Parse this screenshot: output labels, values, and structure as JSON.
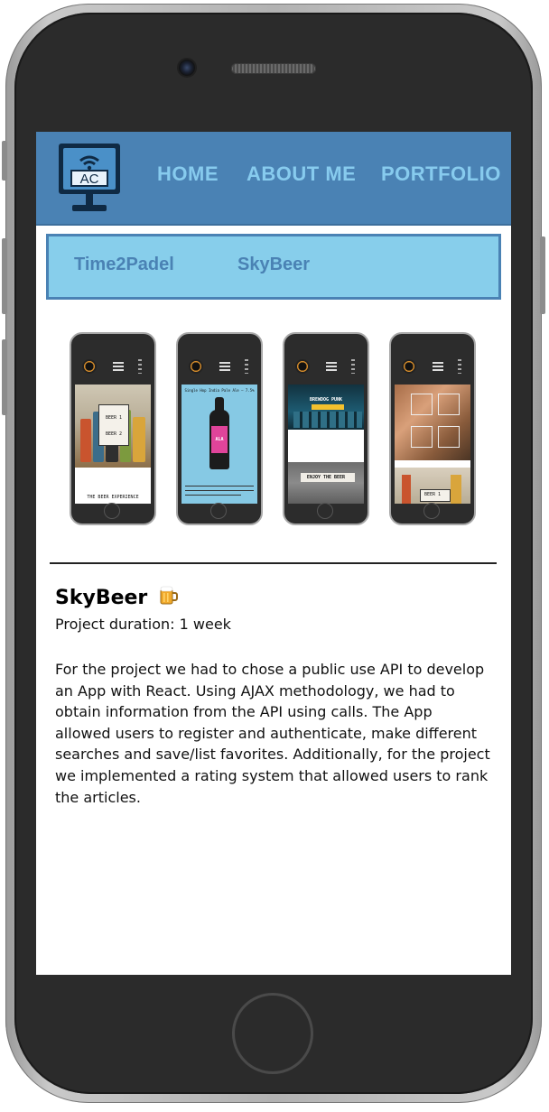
{
  "nav": {
    "logo_text": "AC",
    "links": [
      {
        "label": "HOME"
      },
      {
        "label": "ABOUT ME"
      },
      {
        "label": "PORTFOLIO"
      }
    ]
  },
  "projects_bar": {
    "items": [
      {
        "label": "Time2Padel"
      },
      {
        "label": "SkyBeer"
      }
    ]
  },
  "gallery": {
    "screens": [
      {
        "captions": [
          "BEER 1",
          "BEER 2",
          "THE BEER EXPERIENCE"
        ]
      },
      {
        "captions": [
          "Single Hop India Pale Ale — 7.5%",
          "ALA"
        ]
      },
      {
        "captions": [
          "BREWDOG PUNK",
          "ENJOY THE BEER"
        ]
      },
      {
        "captions": [
          "BEER 1"
        ]
      }
    ]
  },
  "project": {
    "title": "SkyBeer",
    "emoji": "🍺",
    "duration": "Project duration: 1 week",
    "description": "For the project we had to chose a public use API to develop an App with React. Using AJAX methodology, we had to obtain information from the API using calls. The App allowed users to register and authenticate, make different searches and save/list favorites. Additionally, for the project we implemented a rating system that allowed users to rank the articles."
  },
  "colors": {
    "nav_bg": "#4a82b4",
    "nav_text": "#87cbee",
    "projbar_bg": "#87ceeb",
    "projbar_text": "#4a82b4"
  }
}
